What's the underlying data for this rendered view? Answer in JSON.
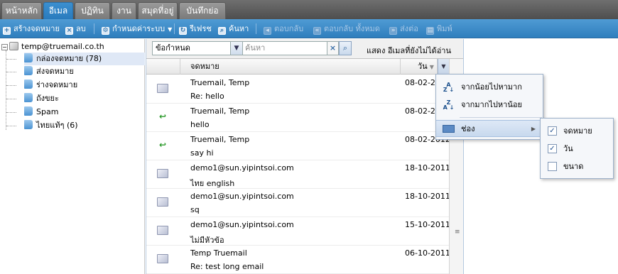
{
  "tabs": [
    {
      "label": "หน้าหลัก",
      "active": false
    },
    {
      "label": "อีเมล",
      "active": true
    },
    {
      "label": "ปฏิทิน",
      "active": false
    },
    {
      "label": "งาน",
      "active": false
    },
    {
      "label": "สมุดที่อยู่",
      "active": false
    },
    {
      "label": "บันทึกย่อ",
      "active": false
    }
  ],
  "toolbar": {
    "compose": "สร้างจดหมาย",
    "delete": "ลบ",
    "settings": "กำหนดค่าระบบ",
    "refresh": "รีเฟรช",
    "search": "ค้นหา",
    "reply": "ตอบกลับ",
    "reply_all": "ตอบกลับ ทั้งหมด",
    "forward": "ส่งต่อ",
    "print": "พิมพ์"
  },
  "tree": {
    "account": "temp@truemail.co.th",
    "folders": [
      {
        "label": "กล่องจดหมาย (78)",
        "selected": true
      },
      {
        "label": "ส่งจดหมาย",
        "selected": false
      },
      {
        "label": "ร่างจดหมาย",
        "selected": false
      },
      {
        "label": "ถังขยะ",
        "selected": false
      },
      {
        "label": "Spam",
        "selected": false
      },
      {
        "label": "ไทยแท้ๆ (6)",
        "selected": false
      }
    ]
  },
  "filter": {
    "field_value": "ข้อกำหนด",
    "search_placeholder": "ค้นหา",
    "unread_link": "แสดง อีเมลที่ยังไม่ได้อ่าน"
  },
  "grid": {
    "headers": {
      "mail": "จดหมาย",
      "date": "วัน"
    },
    "rows": [
      {
        "icon": "envelope",
        "from": "Truemail, Temp",
        "subject": "Re: hello",
        "date": "08-02-2012"
      },
      {
        "icon": "replied",
        "from": "Truemail, Temp",
        "subject": "hello",
        "date": "08-02-2012"
      },
      {
        "icon": "replied",
        "from": "Truemail, Temp",
        "subject": "say hi",
        "date": "08-02-2012"
      },
      {
        "icon": "envelope",
        "from": "demo1@sun.yipintsoi.com",
        "subject": "ไทย english",
        "date": "18-10-2011"
      },
      {
        "icon": "envelope",
        "from": "demo1@sun.yipintsoi.com",
        "subject": "sq",
        "date": "18-10-2011"
      },
      {
        "icon": "envelope",
        "from": "demo1@sun.yipintsoi.com",
        "subject": "ไม่มีหัวข้อ",
        "date": "15-10-2011"
      },
      {
        "icon": "envelope",
        "from": "Temp Truemail",
        "subject": "Re: test long email",
        "date": "06-10-2011"
      }
    ]
  },
  "column_menu": {
    "sort_asc": "จากน้อยไปหามาก",
    "sort_desc": "จากมากไปหาน้อย",
    "columns": "ช่อง",
    "column_options": [
      {
        "label": "จดหมาย",
        "checked": true
      },
      {
        "label": "วัน",
        "checked": true
      },
      {
        "label": "ขนาด",
        "checked": false
      }
    ]
  }
}
